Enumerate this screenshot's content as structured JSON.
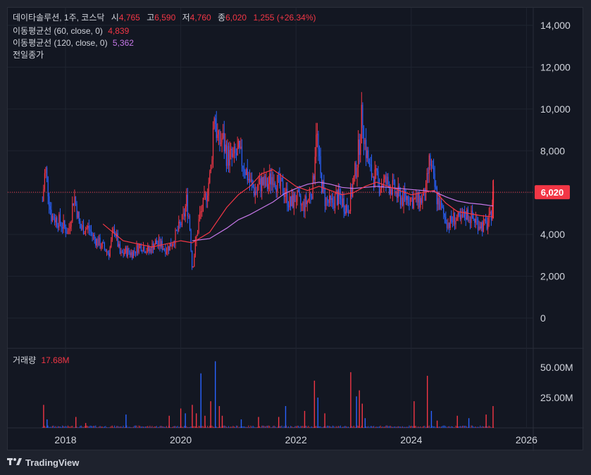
{
  "legend": {
    "title": "데이타솔루션, 1주, 코스닥",
    "o_label": "시",
    "o_value": "4,765",
    "h_label": "고",
    "h_value": "6,590",
    "l_label": "저",
    "l_value": "4,760",
    "c_label": "종",
    "c_value": "6,020",
    "change": "1,255 (+26.34%)",
    "ma60_label": "이동평균선 (60, close, 0)",
    "ma60_value": "4,839",
    "ma120_label": "이동평균선 (120, close, 0)",
    "ma120_value": "5,362",
    "prev_close_label": "전일종가",
    "volume_label": "거래량",
    "volume_value": "17.68M"
  },
  "price_label": "6,020",
  "watermark": "TradingView",
  "colors": {
    "up": "#f23645",
    "down": "#2962ff",
    "ma60": "#f23645",
    "ma120": "#c677e8",
    "bg": "#131722"
  },
  "chart_data": {
    "type": "candlestick",
    "y_ticks": [
      "14,000",
      "12,000",
      "10,000",
      "8,000",
      "6,000",
      "4,000",
      "2,000",
      "0"
    ],
    "y_tick_values": [
      14000,
      12000,
      10000,
      8000,
      6000,
      4000,
      2000,
      0
    ],
    "x_ticks": [
      "2018",
      "2020",
      "2022",
      "2024",
      "2026"
    ],
    "ylim": [
      -1000,
      14500
    ],
    "volume_ticks": [
      "50.00M",
      "25.00M"
    ],
    "volume_tick_values": [
      50,
      25
    ],
    "volume_unit": "M",
    "last_close": 6020,
    "price_path": [
      [
        2017.6,
        5600
      ],
      [
        2017.65,
        7200
      ],
      [
        2017.75,
        4900
      ],
      [
        2017.9,
        4600
      ],
      [
        2018.05,
        4100
      ],
      [
        2018.15,
        5900
      ],
      [
        2018.25,
        4300
      ],
      [
        2018.4,
        4300
      ],
      [
        2018.5,
        3800
      ],
      [
        2018.65,
        3400
      ],
      [
        2018.75,
        3100
      ],
      [
        2018.85,
        4300
      ],
      [
        2018.95,
        3000
      ],
      [
        2019.05,
        3200
      ],
      [
        2019.15,
        3100
      ],
      [
        2019.3,
        3500
      ],
      [
        2019.45,
        3200
      ],
      [
        2019.55,
        3600
      ],
      [
        2019.65,
        3500
      ],
      [
        2019.75,
        3300
      ],
      [
        2019.85,
        3600
      ],
      [
        2019.95,
        4200
      ],
      [
        2020.05,
        4800
      ],
      [
        2020.1,
        5600
      ],
      [
        2020.15,
        4700
      ],
      [
        2020.2,
        2300
      ],
      [
        2020.25,
        3400
      ],
      [
        2020.32,
        4800
      ],
      [
        2020.42,
        5600
      ],
      [
        2020.52,
        7000
      ],
      [
        2020.58,
        9900
      ],
      [
        2020.65,
        8300
      ],
      [
        2020.72,
        8600
      ],
      [
        2020.8,
        7800
      ],
      [
        2020.9,
        7600
      ],
      [
        2021.0,
        7900
      ],
      [
        2021.1,
        7300
      ],
      [
        2021.2,
        6500
      ],
      [
        2021.3,
        6000
      ],
      [
        2021.4,
        6500
      ],
      [
        2021.5,
        6300
      ],
      [
        2021.6,
        6900
      ],
      [
        2021.7,
        6300
      ],
      [
        2021.8,
        6100
      ],
      [
        2021.9,
        5400
      ],
      [
        2022.0,
        5800
      ],
      [
        2022.1,
        5300
      ],
      [
        2022.2,
        5600
      ],
      [
        2022.3,
        6400
      ],
      [
        2022.35,
        9200
      ],
      [
        2022.42,
        6800
      ],
      [
        2022.5,
        5700
      ],
      [
        2022.6,
        5400
      ],
      [
        2022.7,
        5800
      ],
      [
        2022.8,
        5600
      ],
      [
        2022.9,
        5200
      ],
      [
        2023.0,
        6500
      ],
      [
        2023.08,
        7900
      ],
      [
        2023.15,
        9800
      ],
      [
        2023.2,
        8300
      ],
      [
        2023.28,
        7000
      ],
      [
        2023.35,
        6800
      ],
      [
        2023.45,
        6400
      ],
      [
        2023.55,
        6500
      ],
      [
        2023.65,
        6300
      ],
      [
        2023.75,
        5900
      ],
      [
        2023.85,
        5700
      ],
      [
        2023.95,
        5800
      ],
      [
        2024.05,
        5600
      ],
      [
        2024.15,
        5600
      ],
      [
        2024.25,
        5900
      ],
      [
        2024.32,
        7600
      ],
      [
        2024.38,
        6600
      ],
      [
        2024.45,
        5700
      ],
      [
        2024.55,
        5000
      ],
      [
        2024.65,
        4500
      ],
      [
        2024.75,
        4800
      ],
      [
        2024.85,
        4600
      ],
      [
        2024.95,
        5000
      ],
      [
        2025.05,
        4800
      ],
      [
        2025.15,
        4600
      ],
      [
        2025.25,
        4400
      ],
      [
        2025.32,
        4500
      ],
      [
        2025.38,
        4800
      ],
      [
        2025.42,
        6020
      ]
    ],
    "ma60_path": [
      [
        2018.65,
        4500
      ],
      [
        2019.0,
        3700
      ],
      [
        2019.5,
        3400
      ],
      [
        2020.0,
        3700
      ],
      [
        2020.2,
        3600
      ],
      [
        2020.5,
        4100
      ],
      [
        2020.8,
        5300
      ],
      [
        2021.0,
        5900
      ],
      [
        2021.2,
        6300
      ],
      [
        2021.4,
        6900
      ],
      [
        2021.6,
        7100
      ],
      [
        2021.8,
        6700
      ],
      [
        2022.0,
        6300
      ],
      [
        2022.2,
        6100
      ],
      [
        2022.4,
        6300
      ],
      [
        2022.6,
        6100
      ],
      [
        2022.8,
        5900
      ],
      [
        2023.0,
        6000
      ],
      [
        2023.2,
        6300
      ],
      [
        2023.4,
        6500
      ],
      [
        2023.6,
        6300
      ],
      [
        2023.8,
        6100
      ],
      [
        2024.0,
        5900
      ],
      [
        2024.2,
        6000
      ],
      [
        2024.4,
        6100
      ],
      [
        2024.6,
        5500
      ],
      [
        2024.8,
        5100
      ],
      [
        2025.0,
        5000
      ],
      [
        2025.2,
        4900
      ],
      [
        2025.42,
        4839
      ]
    ],
    "ma120_path": [
      [
        2020.2,
        3700
      ],
      [
        2020.5,
        3800
      ],
      [
        2020.8,
        4300
      ],
      [
        2021.0,
        4700
      ],
      [
        2021.2,
        4950
      ],
      [
        2021.4,
        5250
      ],
      [
        2021.6,
        5550
      ],
      [
        2021.8,
        5950
      ],
      [
        2022.0,
        6200
      ],
      [
        2022.2,
        6400
      ],
      [
        2022.4,
        6500
      ],
      [
        2022.6,
        6400
      ],
      [
        2022.8,
        6250
      ],
      [
        2023.0,
        6200
      ],
      [
        2023.2,
        6250
      ],
      [
        2023.4,
        6300
      ],
      [
        2023.6,
        6250
      ],
      [
        2023.8,
        6200
      ],
      [
        2024.0,
        6150
      ],
      [
        2024.2,
        6100
      ],
      [
        2024.4,
        6050
      ],
      [
        2024.6,
        5800
      ],
      [
        2024.8,
        5600
      ],
      [
        2025.0,
        5500
      ],
      [
        2025.2,
        5450
      ],
      [
        2025.42,
        5362
      ]
    ],
    "volume_spikes": [
      [
        2017.62,
        19
      ],
      [
        2017.68,
        7
      ],
      [
        2018.18,
        9
      ],
      [
        2018.35,
        4
      ],
      [
        2019.05,
        11
      ],
      [
        2019.8,
        10
      ],
      [
        2020.0,
        16
      ],
      [
        2020.08,
        12
      ],
      [
        2020.2,
        19
      ],
      [
        2020.27,
        12
      ],
      [
        2020.35,
        45
      ],
      [
        2020.42,
        10
      ],
      [
        2020.52,
        22
      ],
      [
        2020.6,
        55
      ],
      [
        2020.67,
        18
      ],
      [
        2020.72,
        10
      ],
      [
        2021.05,
        7
      ],
      [
        2021.35,
        9
      ],
      [
        2021.7,
        9
      ],
      [
        2021.82,
        18
      ],
      [
        2022.15,
        14
      ],
      [
        2022.32,
        39
      ],
      [
        2022.38,
        25
      ],
      [
        2022.5,
        12
      ],
      [
        2022.95,
        46
      ],
      [
        2023.05,
        26
      ],
      [
        2023.1,
        31
      ],
      [
        2023.15,
        20
      ],
      [
        2023.2,
        8
      ],
      [
        2024.05,
        22
      ],
      [
        2024.28,
        43
      ],
      [
        2024.35,
        14
      ],
      [
        2024.45,
        6
      ],
      [
        2024.8,
        10
      ],
      [
        2025.0,
        8
      ],
      [
        2025.3,
        11
      ],
      [
        2025.42,
        18
      ]
    ]
  }
}
